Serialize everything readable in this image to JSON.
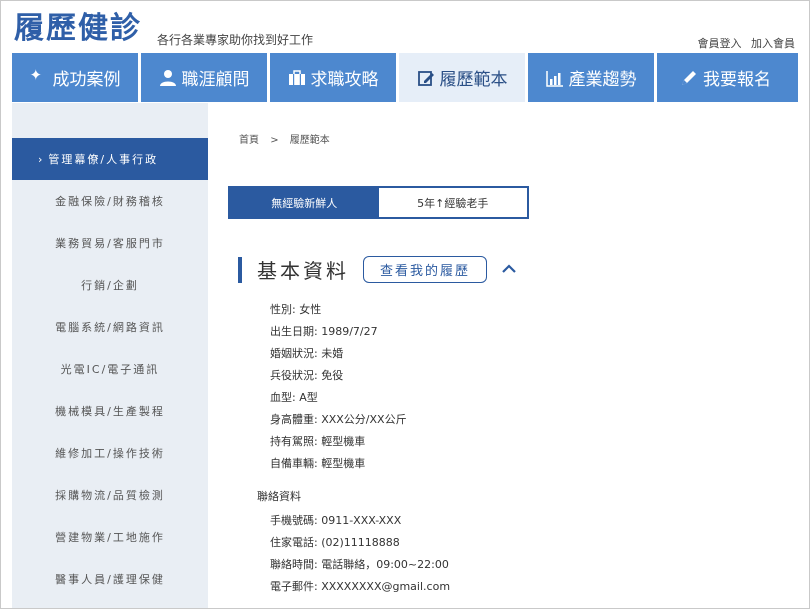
{
  "header": {
    "logo": "履歷健診",
    "slogan": "各行各業專家助你找到好工作",
    "login": "會員登入",
    "register": "加入會員"
  },
  "nav": [
    {
      "label": "成功案例",
      "icon": "sparkle-icon"
    },
    {
      "label": "職涯顧問",
      "icon": "person-icon"
    },
    {
      "label": "求職攻略",
      "icon": "briefcase-icon"
    },
    {
      "label": "履歷範本",
      "icon": "document-edit-icon",
      "active": true
    },
    {
      "label": "產業趨勢",
      "icon": "bar-chart-icon"
    },
    {
      "label": "我要報名",
      "icon": "pen-icon"
    }
  ],
  "sidebar": {
    "active_chevron": "›",
    "items": [
      "管理幕僚/人事行政",
      "金融保險/財務稽核",
      "業務貿易/客服門市",
      "行銷/企劃",
      "電腦系統/網路資訊",
      "光電IC/電子通訊",
      "機械模具/生產製程",
      "維修加工/操作技術",
      "採購物流/品質檢測",
      "營建物業/工地施作",
      "醫事人員/護理保健"
    ]
  },
  "breadcrumb": {
    "home": "首頁",
    "sep": ">",
    "current": "履歷範本"
  },
  "tabs": {
    "tab1": "無經驗新鮮人",
    "tab2": "5年↑經驗老手"
  },
  "section": {
    "title": "基本資料",
    "view_button": "查看我的履歷"
  },
  "basic_info": [
    "性別: 女性",
    "出生日期: 1989/7/27",
    "婚姻狀況: 未婚",
    "兵役狀況: 免役",
    "血型: A型",
    "身高體重: XXX公分/XX公斤",
    "持有駕照: 輕型機車",
    "自備車輛: 輕型機車"
  ],
  "contact": {
    "title": "聯絡資料",
    "rows": [
      "手機號碼: 0911-XXX-XXX",
      "住家電話: (02)11118888",
      "聯絡時間: 電話聯絡，09:00~22:00",
      "電子郵件: XXXXXXXX@gmail.com"
    ]
  },
  "colors": {
    "primary": "#2b5aa0",
    "nav": "#4d88cf",
    "sidebar_bg": "#e9eef4"
  }
}
